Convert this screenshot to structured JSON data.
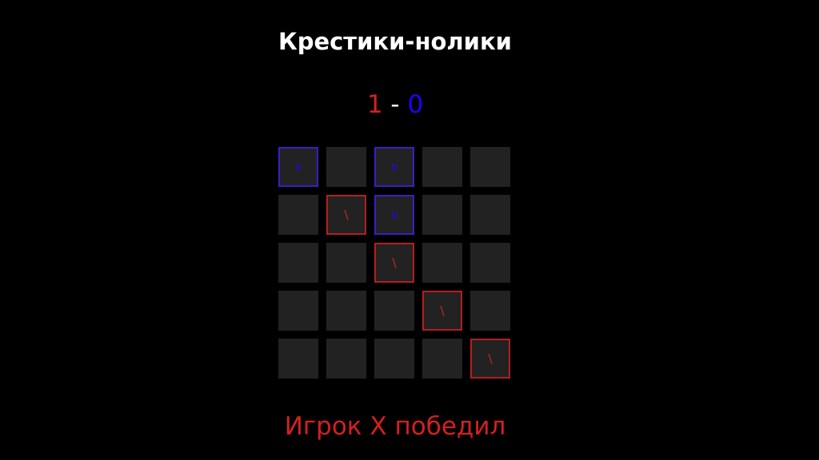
{
  "title": "Крестики-нолики",
  "score": {
    "x": "1",
    "separator": "-",
    "o": "0",
    "x_color": "#d42020",
    "o_color": "#1f00ff"
  },
  "board": {
    "rows": [
      [
        "O",
        "",
        "O",
        "",
        ""
      ],
      [
        "",
        "X",
        "O",
        "",
        ""
      ],
      [
        "",
        "",
        "X",
        "",
        ""
      ],
      [
        "",
        "",
        "",
        "X",
        ""
      ],
      [
        "",
        "",
        "",
        "",
        "X"
      ]
    ],
    "glyphs": {
      "X": "\\",
      "O": "o"
    }
  },
  "status": "Игрок X победил"
}
